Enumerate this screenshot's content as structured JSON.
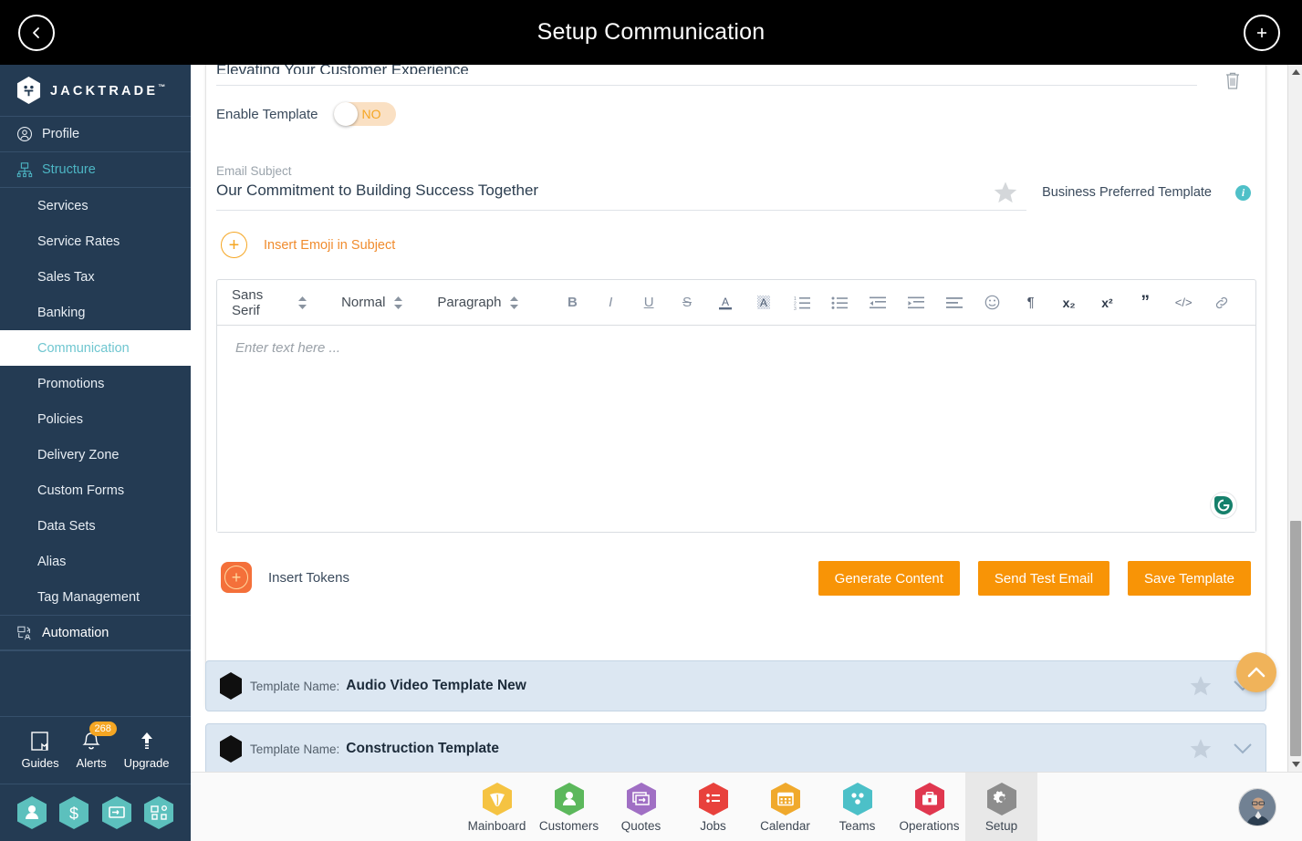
{
  "header": {
    "title": "Setup Communication",
    "back_icon": "chevron-left-icon",
    "add_icon": "plus-icon"
  },
  "sidebar": {
    "brand": "JACKTRADE",
    "brand_tm": "™",
    "items": [
      {
        "label": "Profile",
        "type": "group",
        "icon": "user-circle-icon"
      },
      {
        "label": "Structure",
        "type": "group",
        "icon": "structure-icon",
        "active": true
      },
      {
        "label": "Services",
        "type": "sub"
      },
      {
        "label": "Service Rates",
        "type": "sub"
      },
      {
        "label": "Sales Tax",
        "type": "sub"
      },
      {
        "label": "Banking",
        "type": "sub"
      },
      {
        "label": "Communication",
        "type": "sub",
        "selected": true
      },
      {
        "label": "Promotions",
        "type": "sub"
      },
      {
        "label": "Policies",
        "type": "sub"
      },
      {
        "label": "Delivery Zone",
        "type": "sub"
      },
      {
        "label": "Custom Forms",
        "type": "sub"
      },
      {
        "label": "Data Sets",
        "type": "sub"
      },
      {
        "label": "Alias",
        "type": "sub"
      },
      {
        "label": "Tag Management",
        "type": "sub"
      },
      {
        "label": "Automation",
        "type": "group",
        "icon": "automation-icon"
      }
    ],
    "quick": [
      {
        "label": "Guides",
        "icon": "book-icon"
      },
      {
        "label": "Alerts",
        "icon": "bell-icon",
        "badge": "268"
      },
      {
        "label": "Upgrade",
        "icon": "arrow-up-icon"
      }
    ],
    "hex_shortcuts": [
      {
        "icon": "person-icon",
        "color": "#5cc0bd"
      },
      {
        "icon": "dollar-icon",
        "color": "#5cc0bd"
      },
      {
        "icon": "payment-icon",
        "color": "#5cc0bd"
      },
      {
        "icon": "workflow-icon",
        "color": "#5cc0bd"
      }
    ]
  },
  "form": {
    "truncated_subject_top": "Elevating Your Customer Experience",
    "enable_template_label": "Enable Template",
    "enable_template_value": "NO",
    "email_subject_label": "Email Subject",
    "email_subject_value": "Our Commitment to Building Success Together",
    "business_preferred_label": "Business Preferred Template",
    "insert_emoji_label": "Insert Emoji in Subject",
    "insert_tokens_label": "Insert Tokens",
    "delete_icon": "trash-icon",
    "star_icon": "star-icon",
    "info_icon": "info-icon",
    "info_glyph": "i"
  },
  "editor": {
    "font_family": "Sans Serif",
    "font_size": "Normal",
    "block_format": "Paragraph",
    "placeholder": "Enter text here ...",
    "grammarly_icon": "grammarly-icon",
    "grammarly_glyph": "G",
    "tools": [
      {
        "name": "bold-icon",
        "glyph": "B"
      },
      {
        "name": "italic-icon",
        "glyph": "I"
      },
      {
        "name": "underline-icon",
        "glyph": "U"
      },
      {
        "name": "strikethrough-icon",
        "glyph": "S"
      },
      {
        "name": "text-color-icon",
        "glyph": "A"
      },
      {
        "name": "background-color-icon",
        "glyph": "A"
      },
      {
        "name": "ordered-list-icon",
        "glyph": ""
      },
      {
        "name": "bullet-list-icon",
        "glyph": ""
      },
      {
        "name": "outdent-icon",
        "glyph": ""
      },
      {
        "name": "indent-icon",
        "glyph": ""
      },
      {
        "name": "align-icon",
        "glyph": ""
      },
      {
        "name": "emoji-icon",
        "glyph": "☺"
      },
      {
        "name": "text-direction-icon",
        "glyph": "¶"
      },
      {
        "name": "subscript-icon",
        "glyph": "x₂"
      },
      {
        "name": "superscript-icon",
        "glyph": "x²"
      },
      {
        "name": "blockquote-icon",
        "glyph": "”"
      },
      {
        "name": "code-icon",
        "glyph": "</>"
      },
      {
        "name": "link-icon",
        "glyph": "🔗"
      }
    ]
  },
  "actions": {
    "generate_content": "Generate Content",
    "send_test_email": "Send Test Email",
    "save_template": "Save Template"
  },
  "templates": {
    "name_label": "Template Name:",
    "rows": [
      {
        "name": "Audio Video Template New"
      },
      {
        "name": "Construction Template"
      }
    ]
  },
  "scroll_top": {
    "icon": "chevron-up-icon"
  },
  "bottom_nav": {
    "items": [
      {
        "label": "Mainboard",
        "icon": "mainboard-icon",
        "color": "#f5c342",
        "active": false
      },
      {
        "label": "Customers",
        "icon": "customers-icon",
        "color": "#5cb85c",
        "active": false
      },
      {
        "label": "Quotes",
        "icon": "quotes-icon",
        "color": "#a濃",
        "active": false
      },
      {
        "label": "Jobs",
        "icon": "jobs-icon",
        "color": "#e8413c",
        "active": false
      },
      {
        "label": "Calendar",
        "icon": "calendar-icon",
        "color": "#f0a92c",
        "active": false
      },
      {
        "label": "Teams",
        "icon": "teams-icon",
        "color": "#4cc0c8",
        "active": false
      },
      {
        "label": "Operations",
        "icon": "operations-icon",
        "color": "#e0374f",
        "active": false
      },
      {
        "label": "Setup",
        "icon": "gear-icon",
        "color": "#8d8d8d",
        "active": true
      }
    ],
    "avatar": "user-avatar"
  },
  "colors": {
    "accent_orange": "#f89406",
    "sidebar_bg": "#243b53",
    "teal": "#4db6c4",
    "template_row_bg": "#dce7f2"
  }
}
